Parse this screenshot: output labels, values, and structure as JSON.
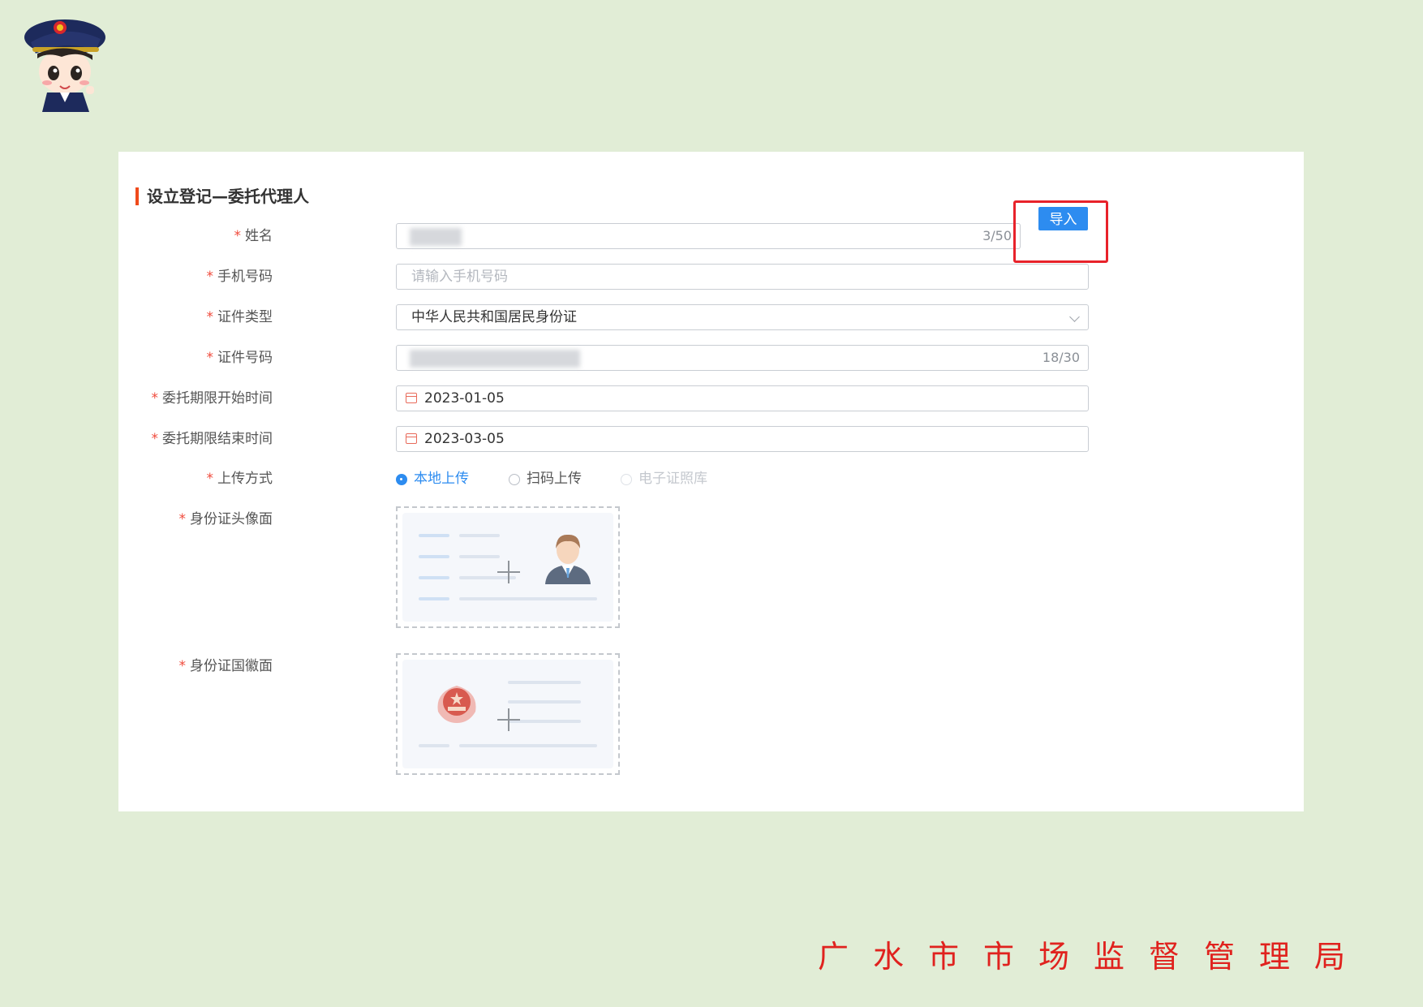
{
  "section_title": "设立登记—委托代理人",
  "form": {
    "name": {
      "label": "姓名",
      "counter": "3/50"
    },
    "import_button": "导入",
    "phone": {
      "label": "手机号码",
      "placeholder": "请输入手机号码"
    },
    "id_type": {
      "label": "证件类型",
      "value": "中华人民共和国居民身份证"
    },
    "id_number": {
      "label": "证件号码",
      "counter": "18/30"
    },
    "start_date": {
      "label": "委托期限开始时间",
      "value": "2023-01-05"
    },
    "end_date": {
      "label": "委托期限结束时间",
      "value": "2023-03-05"
    },
    "upload_method": {
      "label": "上传方式",
      "options": [
        "本地上传",
        "扫码上传",
        "电子证照库"
      ],
      "selected": "本地上传"
    },
    "id_front": {
      "label": "身份证头像面"
    },
    "id_back": {
      "label": "身份证国徽面"
    }
  },
  "required_mark": "*",
  "footer": "广水市市场监督管理局",
  "colors": {
    "page_background": "#e1edd6",
    "accent_blue": "#2d8cf0",
    "highlight_red": "#e8222a",
    "title_bar": "#f04a1b",
    "footer_red": "#e0221e"
  },
  "icons": [
    "mascot-logo",
    "chevron-down-icon",
    "calendar-icon",
    "plus-icon",
    "avatar-icon",
    "national-emblem-icon"
  ]
}
